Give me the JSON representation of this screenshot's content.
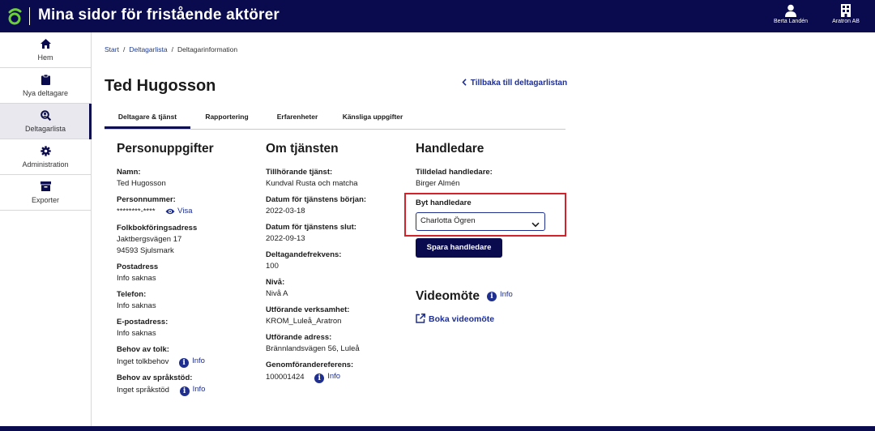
{
  "header": {
    "app_title": "Mina sidor för fristående aktörer",
    "user_name": "Berta Landén",
    "org_name": "Aratron AB"
  },
  "sidebar": {
    "items": [
      {
        "label": "Hem",
        "icon": "home-icon"
      },
      {
        "label": "Nya deltagare",
        "icon": "clipboard-icon"
      },
      {
        "label": "Deltagarlista",
        "icon": "search-person-icon",
        "active": true
      },
      {
        "label": "Administration",
        "icon": "gear-icon"
      },
      {
        "label": "Exporter",
        "icon": "archive-icon"
      }
    ]
  },
  "breadcrumb": {
    "start": "Start",
    "list": "Deltagarlista",
    "current": "Deltagarinformation",
    "separator": "/"
  },
  "page": {
    "title": "Ted Hugosson",
    "back_link": "Tillbaka till deltagarlistan"
  },
  "tabs": [
    {
      "label": "Deltagare & tjänst",
      "active": true
    },
    {
      "label": "Rapportering"
    },
    {
      "label": "Erfarenheter"
    },
    {
      "label": "Känsliga uppgifter"
    }
  ],
  "person": {
    "heading": "Personuppgifter",
    "name_label": "Namn:",
    "name_value": "Ted Hugosson",
    "pnr_label": "Personnummer:",
    "pnr_value": "********-****",
    "pnr_show": "Visa",
    "address_label": "Folkbokföringsadress",
    "address_line1": "Jaktbergsvägen 17",
    "address_line2": "94593 Sjulsmark",
    "postal_label": "Postadress",
    "postal_value": "Info saknas",
    "phone_label": "Telefon:",
    "phone_value": "Info saknas",
    "email_label": "E-postadress:",
    "email_value": "Info saknas",
    "interpreter_label": "Behov av tolk:",
    "interpreter_value": "Inget tolkbehov",
    "language_label": "Behov av språkstöd:",
    "language_value": "Inget språkstöd",
    "info_label": "Info"
  },
  "service": {
    "heading": "Om tjänsten",
    "service_label": "Tillhörande tjänst:",
    "service_value": "Kundval Rusta och matcha",
    "start_label": "Datum för tjänstens början:",
    "start_value": "2022-03-18",
    "end_label": "Datum för tjänstens slut:",
    "end_value": "2022-09-13",
    "freq_label": "Deltagandefrekvens:",
    "freq_value": "100",
    "level_label": "Nivå:",
    "level_value": "Nivå A",
    "org_label": "Utförande verksamhet:",
    "org_value": "KROM_Luleå_Aratron",
    "addr_label": "Utförande adress:",
    "addr_value": "Brännlandsvägen 56, Luleå",
    "ref_label": "Genomförandereferens:",
    "ref_value": "100001424",
    "info_label": "Info"
  },
  "handler": {
    "heading": "Handledare",
    "assigned_label": "Tilldelad handledare:",
    "assigned_value": "Birger Almén",
    "change_label": "Byt handledare",
    "select_value": "Charlotta Ögren",
    "save_button": "Spara handledare"
  },
  "video": {
    "heading": "Videomöte",
    "info_label": "Info",
    "book_link": "Boka videomöte"
  },
  "colors": {
    "brand_navy": "#0a0a4f",
    "link_blue": "#1f2f8f",
    "highlight_red": "#d3222a",
    "logo_green": "#6ccf3a"
  }
}
